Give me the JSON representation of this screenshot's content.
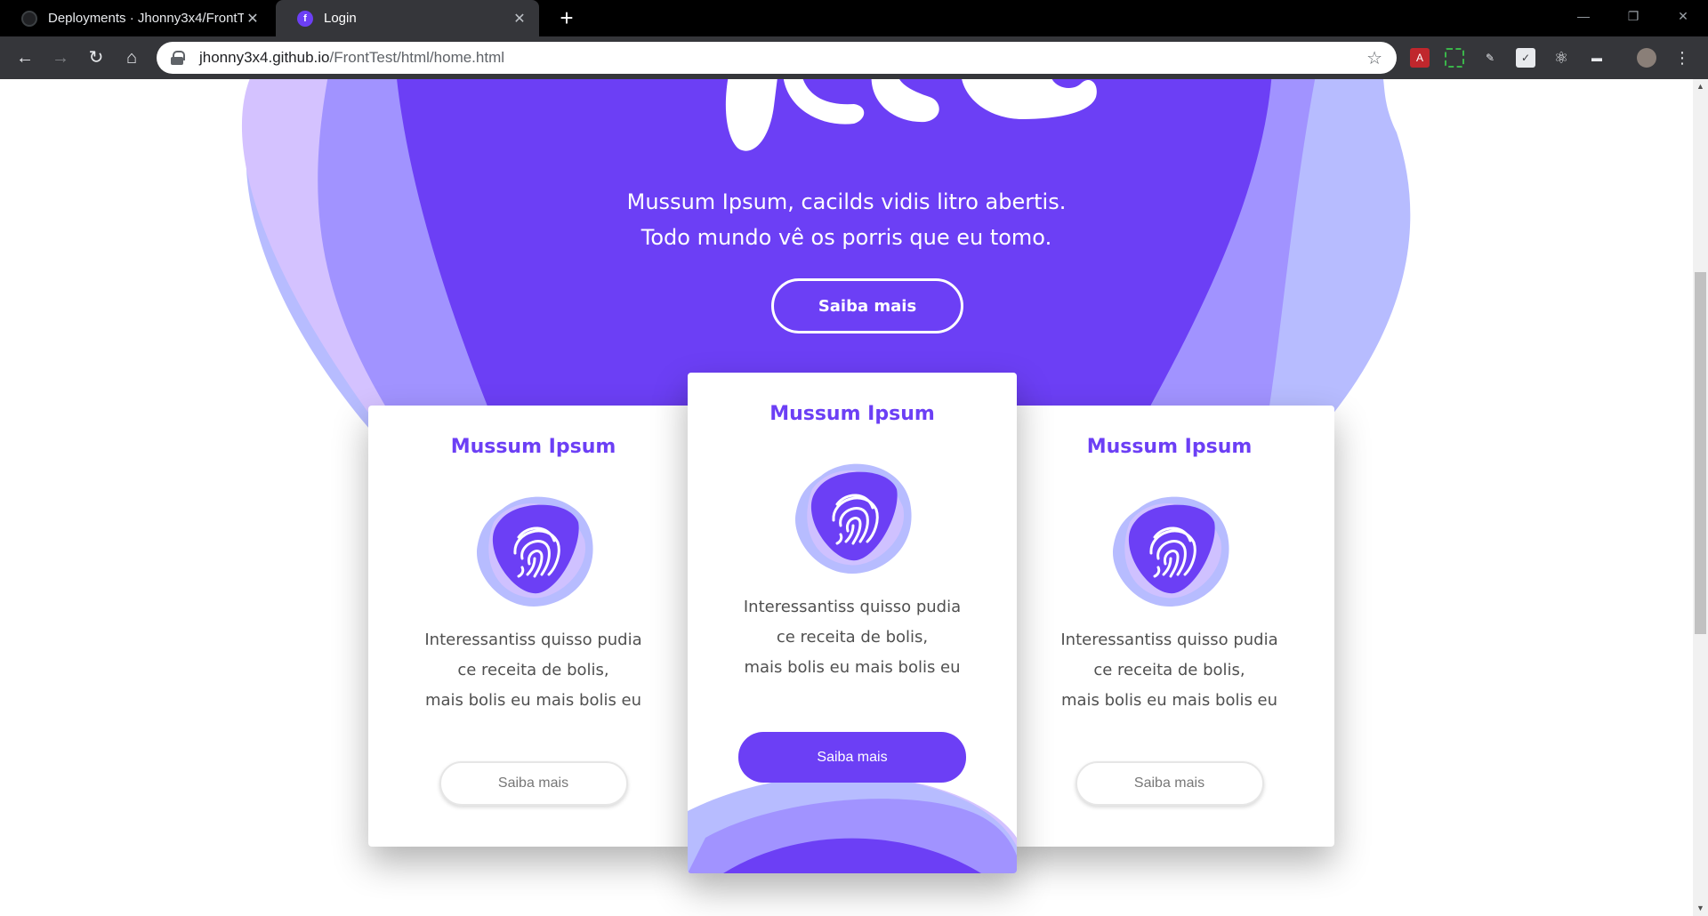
{
  "browser": {
    "tabs": [
      {
        "title": "Deployments · Jhonny3x4/FrontT",
        "icon": "github-icon",
        "active": false
      },
      {
        "title": "Login",
        "icon": "fronttest-favicon",
        "active": true
      }
    ],
    "new_tab_label": "+",
    "url_host": "jhonny3x4.github.io",
    "url_path": "/FrontTest/html/home.html"
  },
  "hero": {
    "line1": "Mussum Ipsum, cacilds vidis litro abertis.",
    "line2": "Todo mundo vê os porris que eu tomo.",
    "button_label": "Saiba mais"
  },
  "cards": [
    {
      "title": "Mussum Ipsum",
      "icon": "fingerprint-icon",
      "text_lines": [
        "Interessantiss quisso pudia",
        "ce receita de bolis,",
        "mais bolis eu mais bolis eu"
      ],
      "button_label": "Saiba mais"
    },
    {
      "title": "Mussum Ipsum",
      "icon": "fingerprint-icon",
      "text_lines": [
        "Interessantiss quisso pudia",
        "ce receita de bolis,",
        "mais bolis eu mais bolis eu"
      ],
      "button_label": "Saiba mais"
    },
    {
      "title": "Mussum Ipsum",
      "icon": "fingerprint-icon",
      "text_lines": [
        "Interessantiss quisso pudia",
        "ce receita de bolis,",
        "mais bolis eu mais bolis eu"
      ],
      "button_label": "Saiba mais"
    }
  ],
  "colors": {
    "primary": "#6c3ff5",
    "blob_light": "#a193ff",
    "blob_lavender": "#d4c2ff",
    "blob_periwinkle": "#b7bcff"
  }
}
